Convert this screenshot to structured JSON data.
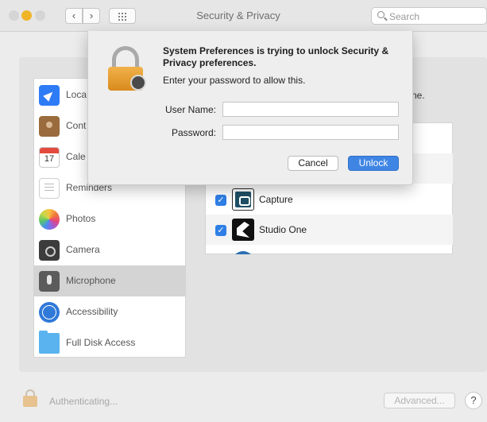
{
  "window": {
    "title": "Security & Privacy",
    "search_placeholder": "Search"
  },
  "sidebar": {
    "items": [
      {
        "label": "Loca",
        "icon": "location-icon"
      },
      {
        "label": "Cont",
        "icon": "contacts-icon"
      },
      {
        "label": "Cale",
        "icon": "calendar-icon",
        "badge": "17"
      },
      {
        "label": "Reminders",
        "icon": "reminders-icon"
      },
      {
        "label": "Photos",
        "icon": "photos-icon"
      },
      {
        "label": "Camera",
        "icon": "camera-icon"
      },
      {
        "label": "Microphone",
        "icon": "microphone-icon",
        "selected": true
      },
      {
        "label": "Accessibility",
        "icon": "accessibility-icon"
      },
      {
        "label": "Full Disk Access",
        "icon": "folder-icon"
      }
    ]
  },
  "main": {
    "description_tail": "ne.",
    "apps": [
      {
        "name": "Capture",
        "checked": true,
        "icon": "capture-app-icon"
      },
      {
        "name": "Studio One",
        "checked": true,
        "icon": "studio-one-app-icon"
      }
    ]
  },
  "footer": {
    "status": "Authenticating...",
    "advanced_label": "Advanced...",
    "help_label": "?"
  },
  "dialog": {
    "title": "System Preferences is trying to unlock Security & Privacy preferences.",
    "message": "Enter your password to allow this.",
    "username_label": "User Name:",
    "username_value": "",
    "password_label": "Password:",
    "password_value": "",
    "cancel_label": "Cancel",
    "unlock_label": "Unlock"
  },
  "colors": {
    "accent": "#3f85e4",
    "lock_gold": "#e9a23b",
    "selected_row": "#d4d4d4"
  }
}
